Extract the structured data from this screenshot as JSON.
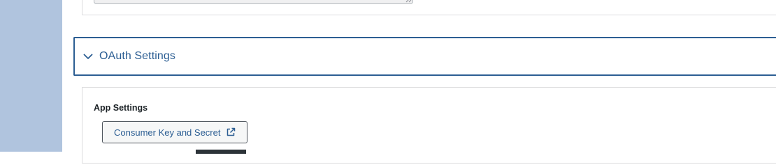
{
  "sidebar": {
    "color": "#b0c4de"
  },
  "oauth_section": {
    "title": "OAuth Settings",
    "expanded": true,
    "toggle_icon": "chevron-down-icon",
    "accent_color": "#2c5e93"
  },
  "app_settings": {
    "label": "App Settings",
    "consumer_button": {
      "label": "Consumer Key and Secret",
      "icon": "external-link-icon"
    }
  }
}
